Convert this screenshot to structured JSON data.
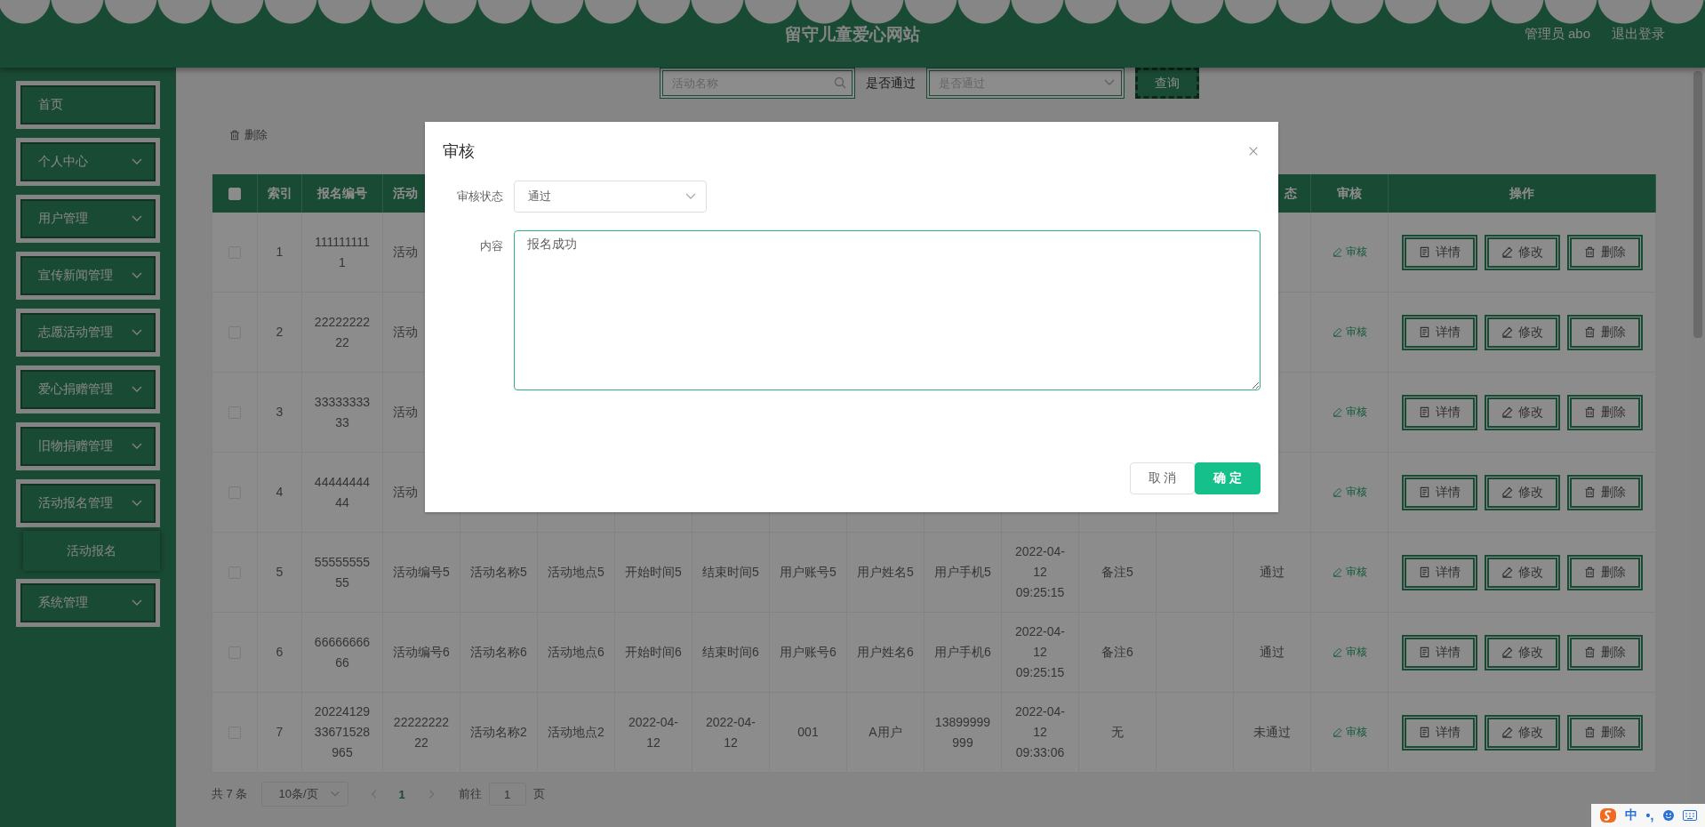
{
  "header": {
    "title": "留守儿童爱心网站",
    "user": "管理员 abo",
    "logout": "退出登录"
  },
  "sidebar": {
    "items": [
      {
        "label": "首页",
        "kind": "link"
      },
      {
        "label": "个人中心",
        "kind": "submenu"
      },
      {
        "label": "用户管理",
        "kind": "submenu"
      },
      {
        "label": "宣传新闻管理",
        "kind": "submenu"
      },
      {
        "label": "志愿活动管理",
        "kind": "submenu"
      },
      {
        "label": "爱心捐赠管理",
        "kind": "submenu"
      },
      {
        "label": "旧物捐赠管理",
        "kind": "submenu"
      },
      {
        "label": "活动报名管理",
        "kind": "submenu",
        "children": [
          {
            "label": "活动报名"
          }
        ]
      },
      {
        "label": "系统管理",
        "kind": "submenu"
      }
    ]
  },
  "search": {
    "name_field": {
      "placeholder": "活动名称"
    },
    "pass_label": "是否通过",
    "pass_select": {
      "placeholder": "是否通过"
    },
    "button": "查询"
  },
  "toolbar": {
    "delete_button": "删除"
  },
  "table": {
    "select_all": {
      "checked": false
    },
    "leading_columns": [
      "索引",
      "报名编号",
      "活动"
    ],
    "trailing_columns": [
      "态",
      "审核",
      "操作"
    ],
    "rows": [
      {
        "checked": false,
        "cells": [
          "1",
          "1111111111",
          "活动"
        ],
        "review": "审核",
        "actions": [
          "详情",
          "修改",
          "删除"
        ]
      },
      {
        "checked": false,
        "cells": [
          "2",
          "2222222222",
          "活动"
        ],
        "review": "审核",
        "actions": [
          "详情",
          "修改",
          "删除"
        ]
      },
      {
        "checked": false,
        "cells": [
          "3",
          "3333333333",
          "活动"
        ],
        "review": "审核",
        "actions": [
          "详情",
          "修改",
          "删除"
        ]
      },
      {
        "checked": false,
        "cells": [
          "4",
          "4444444444",
          "活动"
        ],
        "review": "审核",
        "actions": [
          "详情",
          "修改",
          "删除"
        ]
      },
      {
        "checked": false,
        "cells": [
          "5",
          "5555555555",
          "活动编号5",
          "活动名称5",
          "活动地点5",
          "开始时间5",
          "结束时间5",
          "用户账号5",
          "用户姓名5",
          "用户手机5",
          "2022-04-12 09:25:15",
          "备注5"
        ],
        "review_status": "通过",
        "review": "审核",
        "actions": [
          "详情",
          "修改",
          "删除"
        ]
      },
      {
        "checked": false,
        "cells": [
          "6",
          "6666666666",
          "活动编号6",
          "活动名称6",
          "活动地点6",
          "开始时间6",
          "结束时间6",
          "用户账号6",
          "用户姓名6",
          "用户手机6",
          "2022-04-12 09:25:15",
          "备注6"
        ],
        "review_status": "通过",
        "review": "审核",
        "actions": [
          "详情",
          "修改",
          "删除"
        ]
      },
      {
        "checked": false,
        "cells": [
          "7",
          "2022412933671528965",
          "2222222222",
          "活动名称2",
          "活动地点2",
          "2022-04-12",
          "2022-04-12",
          "001",
          "A用户",
          "13899999999",
          "2022-04-12 09:33:06",
          "无"
        ],
        "review_status": "未通过",
        "review": "审核",
        "actions": [
          "详情",
          "修改",
          "删除"
        ]
      }
    ]
  },
  "pagination": {
    "total": "共 7 条",
    "page_size": "10条/页",
    "pages": [
      {
        "label": "1",
        "selected": true
      }
    ],
    "goto_label": "前往",
    "goto_value": "1",
    "goto_suffix": "页"
  },
  "dialog": {
    "title": "审核",
    "fields": [
      {
        "kind": "select",
        "label": "审核状态",
        "value": "通过"
      },
      {
        "kind": "textarea",
        "label": "内容",
        "value": "报名成功"
      }
    ],
    "buttons": [
      {
        "label": "取 消",
        "kind": "default"
      },
      {
        "label": "确 定",
        "kind": "primary"
      }
    ]
  },
  "ime": {
    "mode": "中",
    "punct": "•,"
  }
}
